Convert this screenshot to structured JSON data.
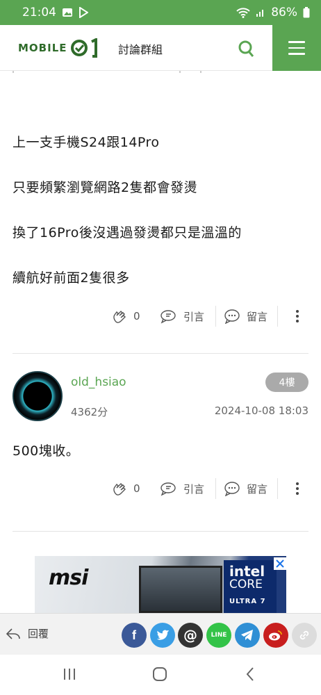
{
  "status_bar": {
    "time": "21:04",
    "battery": "86%"
  },
  "header": {
    "logo_text": "MOBILE",
    "section_title": "討論群組"
  },
  "post": {
    "lines": [
      "上一支手機S24跟14Pro",
      "只要頻繁瀏覽網路2隻都會發燙",
      "換了16Pro後沒遇過發燙都只是溫溫的",
      "續航好前面2隻很多"
    ],
    "likes": "0",
    "quote_label": "引言",
    "comment_label": "留言"
  },
  "reply_post": {
    "username": "old_hsiao",
    "points": "4362分",
    "floor": "4樓",
    "timestamp": "2024-10-08 18:03",
    "content": "500塊收。",
    "likes": "0",
    "quote_label": "引言",
    "comment_label": "留言"
  },
  "ad": {
    "brand": "msi",
    "intel_line1": "intel",
    "intel_line2": "CORE",
    "intel_line3": "ULTRA 7"
  },
  "share_bar": {
    "reply_label": "回覆",
    "buttons": [
      {
        "name": "facebook",
        "glyph": "f",
        "color": "#3b5998"
      },
      {
        "name": "twitter",
        "glyph": "",
        "color": "#3a9ee5"
      },
      {
        "name": "threads",
        "glyph": "@",
        "color": "#333333"
      },
      {
        "name": "line",
        "glyph": "LINE",
        "color": "#33c348"
      },
      {
        "name": "telegram",
        "glyph": "",
        "color": "#2f8fd5"
      },
      {
        "name": "weibo",
        "glyph": "",
        "color": "#c81e1e"
      },
      {
        "name": "copy-link",
        "glyph": "",
        "color": "#dcdcdc"
      }
    ]
  }
}
